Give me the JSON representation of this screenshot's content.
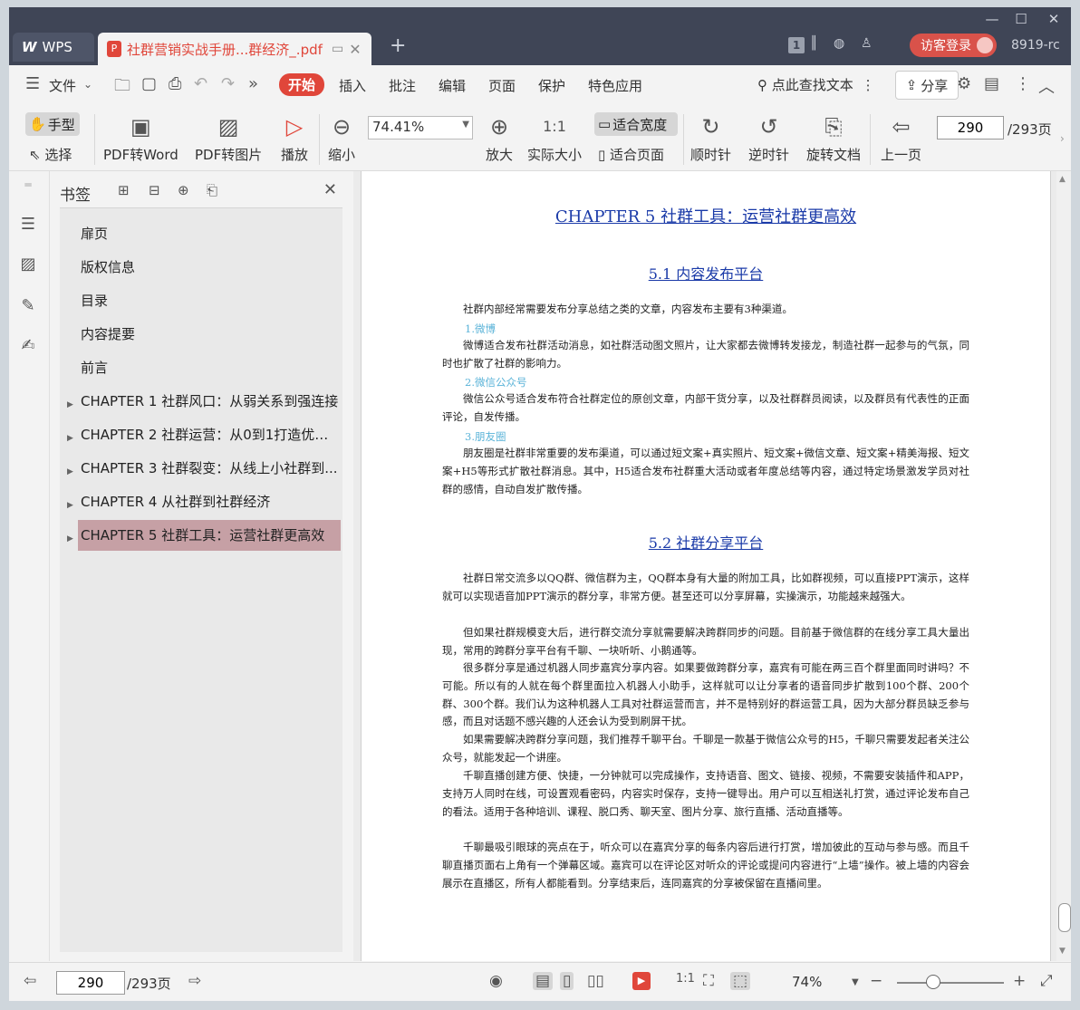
{
  "window": {
    "tabs": [
      {
        "label": "WPS"
      },
      {
        "label": "社群营销实战手册...群经济_.pdf"
      }
    ],
    "page_badge": "1",
    "login_label": "访客登录",
    "version": "8919-rc"
  },
  "menu": {
    "file": "文件",
    "items": [
      "开始",
      "插入",
      "批注",
      "编辑",
      "页面",
      "保护",
      "特色应用"
    ],
    "search": "点此查找文本",
    "share": "分享"
  },
  "toolbar": {
    "hand": "手型",
    "select": "选择",
    "pdf_to_word": "PDF转Word",
    "pdf_to_image": "PDF转图片",
    "play": "播放",
    "zoom_out": "缩小",
    "zoom_value": "74.41%",
    "zoom_in": "放大",
    "actual_size": "实际大小",
    "fit_width": "适合宽度",
    "fit_page": "适合页面",
    "clockwise": "顺时针",
    "counterclockwise": "逆时针",
    "rotate_doc": "旋转文档",
    "prev_page": "上一页",
    "page_current": "290",
    "page_total": "/293页"
  },
  "bookmarks": {
    "title": "书签",
    "items": [
      {
        "label": "扉页",
        "expandable": false
      },
      {
        "label": "版权信息",
        "expandable": false
      },
      {
        "label": "目录",
        "expandable": false
      },
      {
        "label": "内容提要",
        "expandable": false
      },
      {
        "label": "前言",
        "expandable": false
      },
      {
        "label": "CHAPTER 1 社群风口：从弱关系到强连接",
        "expandable": true
      },
      {
        "label": "CHAPTER 2 社群运营：从0到1打造优质...",
        "expandable": true
      },
      {
        "label": "CHAPTER 3 社群裂变：从线上小社群到...",
        "expandable": true
      },
      {
        "label": "CHAPTER 4 从社群到社群经济",
        "expandable": true
      },
      {
        "label": "CHAPTER 5 社群工具：运营社群更高效",
        "expandable": true,
        "selected": true
      }
    ]
  },
  "document": {
    "chapter_title": "CHAPTER 5 社群工具：运营社群更高效",
    "sec1_title": "5.1 内容发布平台",
    "sec1_intro": "社群内部经常需要发布分享总结之类的文章，内容发布主要有3种渠道。",
    "sub1": "1.微博",
    "sub1_text": "微博适合发布社群活动消息，如社群活动图文照片，让大家都去微博转发接龙，制造社群一起参与的气氛，同时也扩散了社群的影响力。",
    "sub2": "2.微信公众号",
    "sub2_text": "微信公众号适合发布符合社群定位的原创文章，内部干货分享，以及社群群员阅读，以及群员有代表性的正面评论，自发传播。",
    "sub3": "3.朋友圈",
    "sub3_text": "朋友圈是社群非常重要的发布渠道，可以通过短文案+真实照片、短文案+微信文章、短文案+精美海报、短文案+H5等形式扩散社群消息。其中，H5适合发布社群重大活动或者年度总结等内容，通过特定场景激发学员对社群的感情，自动自发扩散传播。",
    "sec2_title": "5.2 社群分享平台",
    "sec2_p1": "社群日常交流多以QQ群、微信群为主，QQ群本身有大量的附加工具，比如群视频，可以直接PPT演示，这样就可以实现语音加PPT演示的群分享，非常方便。甚至还可以分享屏幕，实操演示，功能越来越强大。",
    "sec2_p2": "但如果社群规模变大后，进行群交流分享就需要解决跨群同步的问题。目前基于微信群的在线分享工具大量出现，常用的跨群分享平台有千聊、一块听听、小鹅通等。",
    "sec2_p3": "很多群分享是通过机器人同步嘉宾分享内容。如果要做跨群分享，嘉宾有可能在两三百个群里面同时讲吗？不可能。所以有的人就在每个群里面拉入机器人小助手，这样就可以让分享者的语音同步扩散到100个群、200个群、300个群。我们认为这种机器人工具对社群运营而言，并不是特别好的群运营工具，因为大部分群员缺乏参与感，而且对话题不感兴趣的人还会认为受到刷屏干扰。",
    "sec2_p4": "如果需要解决跨群分享问题，我们推荐千聊平台。千聊是一款基于微信公众号的H5，千聊只需要发起者关注公众号，就能发起一个讲座。",
    "sec2_p5": "千聊直播创建方便、快捷，一分钟就可以完成操作，支持语音、图文、链接、视频，不需要安装插件和APP，支持万人同时在线，可设置观看密码，内容实时保存，支持一键导出。用户可以互相送礼打赏，通过评论发布自己的看法。适用于各种培训、课程、脱口秀、聊天室、图片分享、旅行直播、活动直播等。",
    "sec2_p6": "千聊最吸引眼球的亮点在于，听众可以在嘉宾分享的每条内容后进行打赏，增加彼此的互动与参与感。而且千聊直播页面右上角有一个弹幕区域。嘉宾可以在评论区对听众的评论或提问内容进行“上墙”操作。被上墙的内容会展示在直播区，所有人都能看到。分享结束后，连同嘉宾的分享被保留在直播间里。"
  },
  "statusbar": {
    "page_current": "290",
    "page_total": "/293页",
    "zoom": "74%"
  },
  "colors": {
    "accent": "#e0463a",
    "titlebar": "#3f4556",
    "link": "#1a3aa8",
    "subheading": "#5ab3d8",
    "bookmark_selected": "#c6a0a5"
  }
}
